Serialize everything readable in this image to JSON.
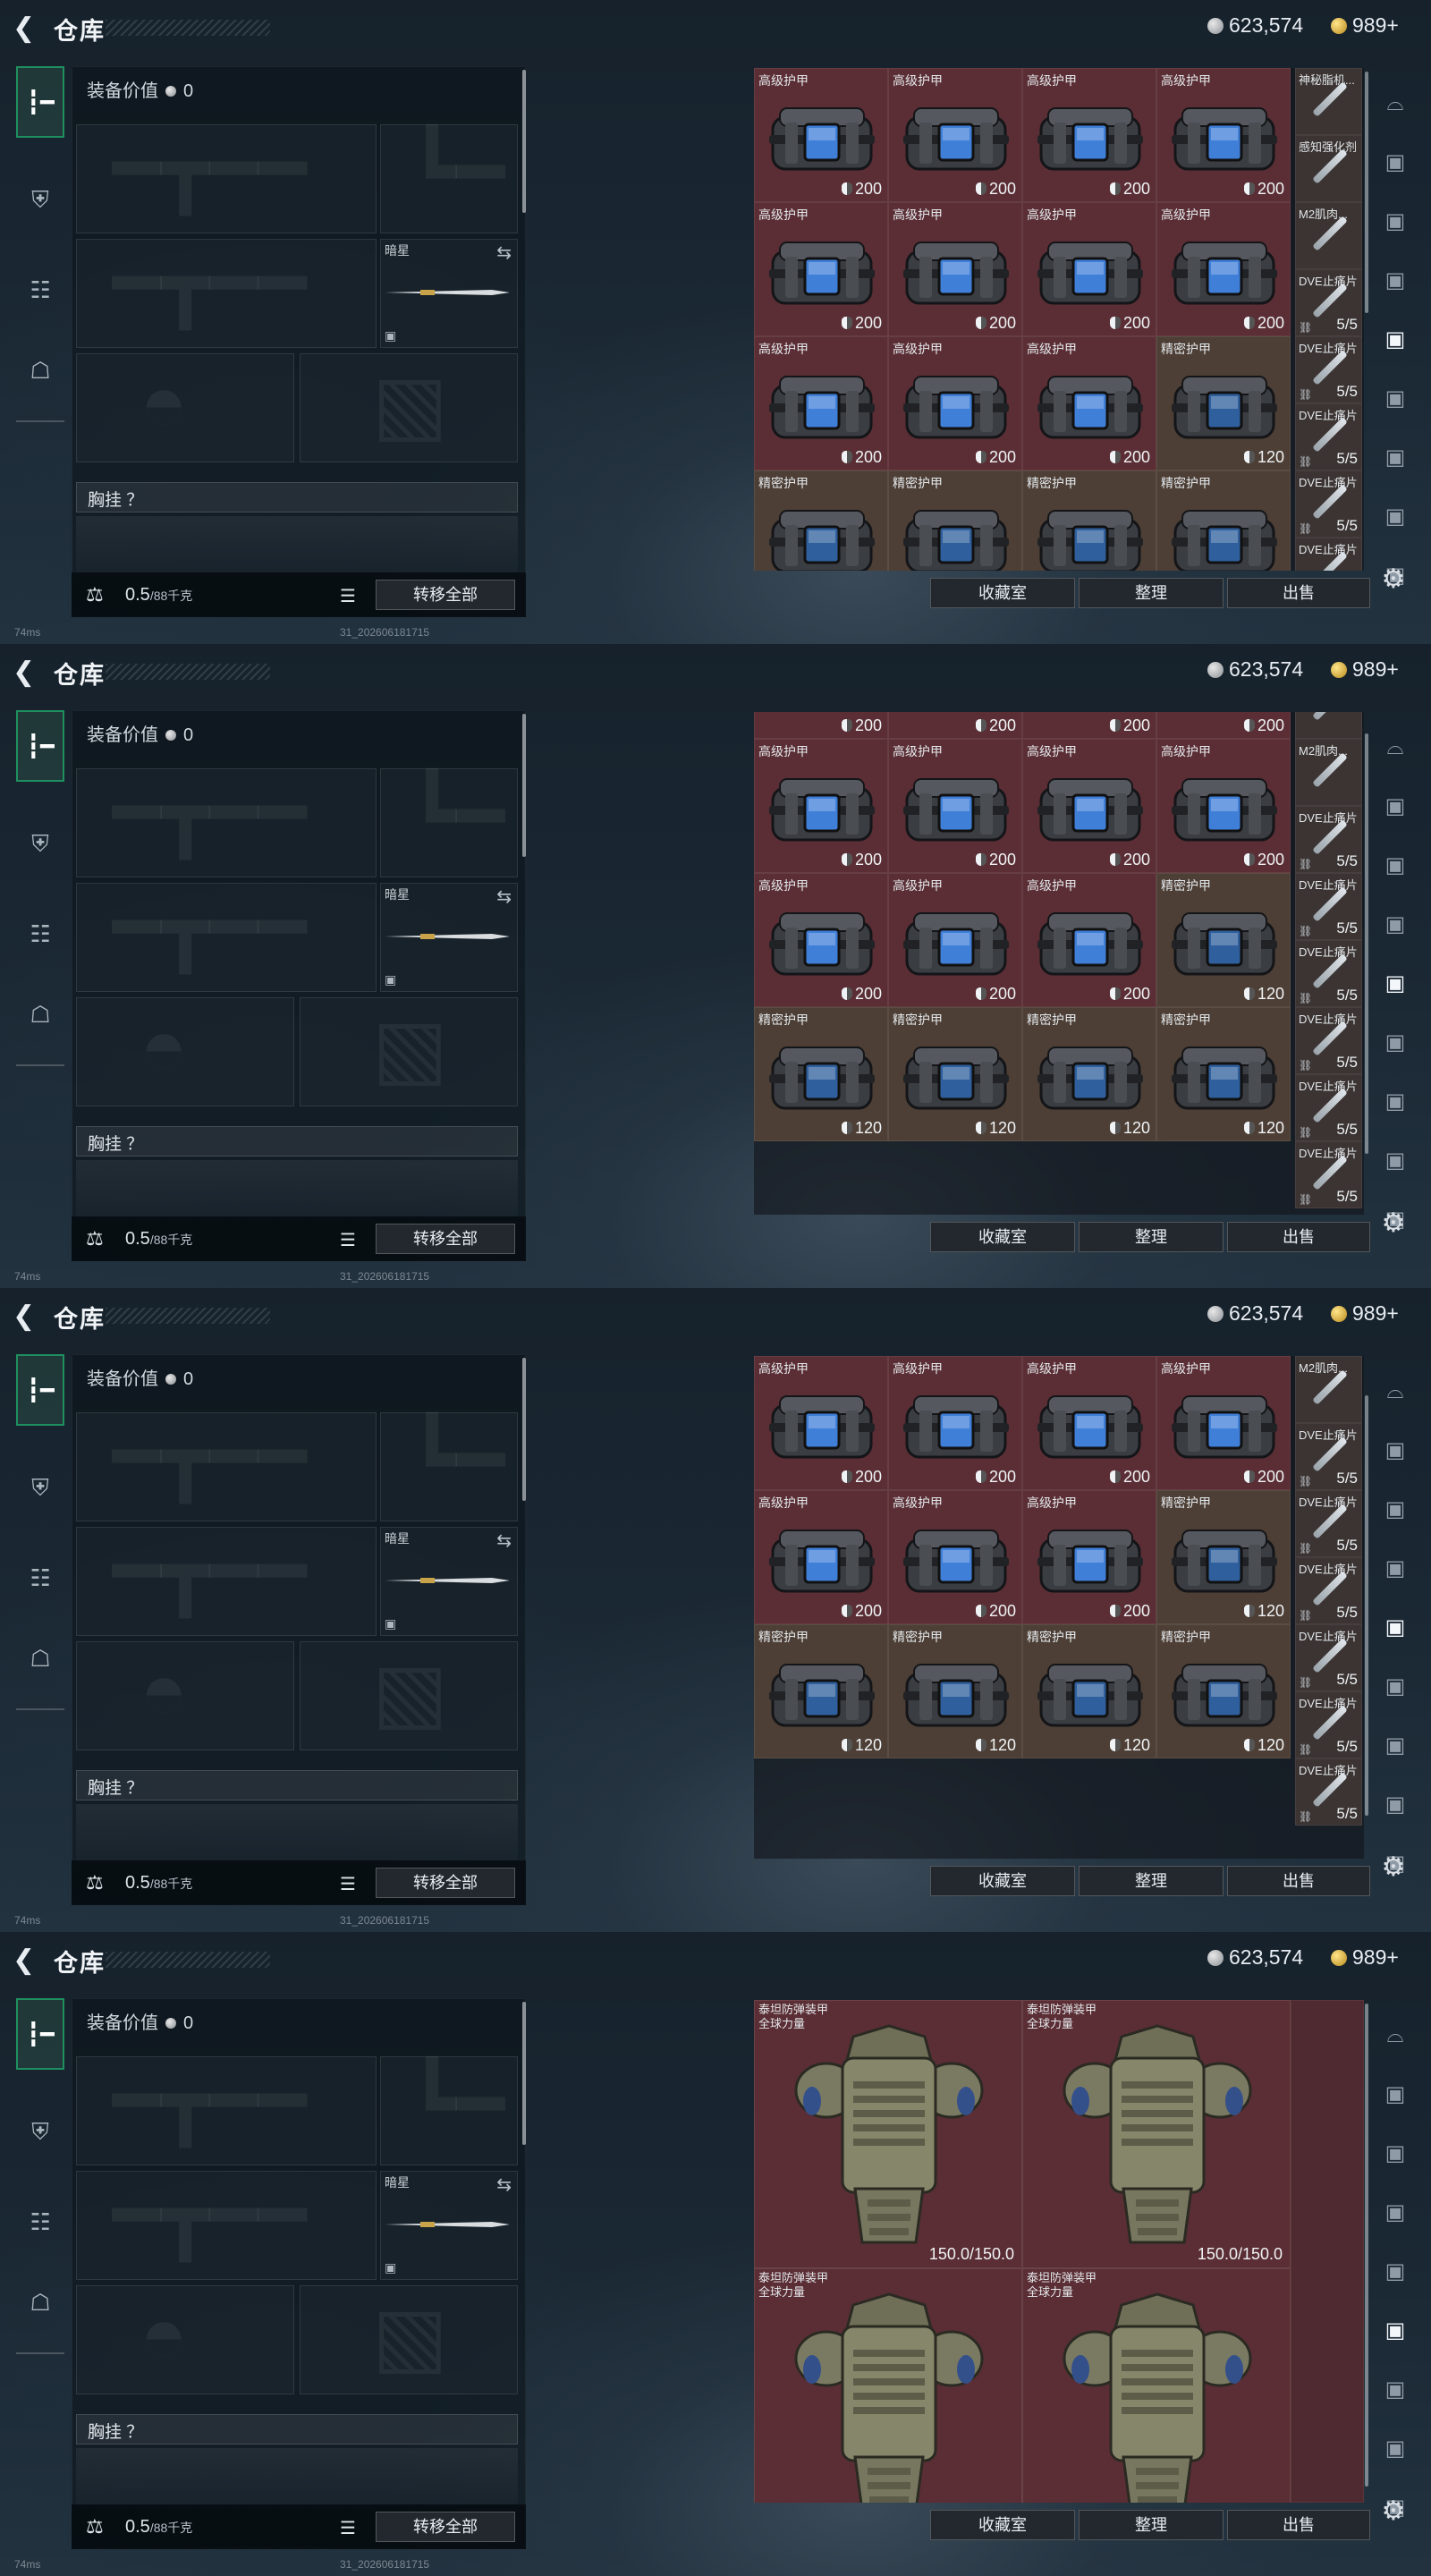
{
  "header": {
    "title": "仓库",
    "silver": "623,574",
    "gold": "989+"
  },
  "left": {
    "equip_label": "装备价值",
    "equip_value": "0",
    "melee_name": "暗星",
    "chest_label": "胸挂 ？",
    "weight": "0.5",
    "weight_unit": "/88千克",
    "transfer_all": "转移全部"
  },
  "status": {
    "ping": "74ms",
    "build": "31_202606181715"
  },
  "buttons": {
    "collection": "收藏室",
    "sort": "整理",
    "sell": "出售"
  },
  "names": {
    "adv": "高级护甲",
    "pre": "精密护甲",
    "dve": "DVE止痛片",
    "m2": "M2肌肉...",
    "sg": "神秘脂机...",
    "zx": "感知强化剂",
    "tai1": "泰坦防弹装甲",
    "tai2": "全球力量"
  },
  "values": {
    "d200": "200",
    "d120": "120",
    "q55": "5/5",
    "armor_dur": "150.0/150.0"
  },
  "frames": [
    {
      "rows": [
        {
          "type": "adv",
          "dur": "200",
          "bg": "red",
          "label": true
        },
        {
          "type": "adv",
          "dur": "200",
          "bg": "red",
          "label": true
        },
        {
          "type": "mix",
          "label": true
        },
        {
          "type": "pre",
          "dur": "",
          "bg": "brown",
          "label": true
        }
      ]
    }
  ],
  "colors": {
    "red_cell": "#5a2e34",
    "brown_cell": "#4d3f35",
    "accent_green": "#1f8f5f",
    "screen_blue": "#3f7fd8",
    "screen_blue_dim": "#2f5f9c"
  }
}
